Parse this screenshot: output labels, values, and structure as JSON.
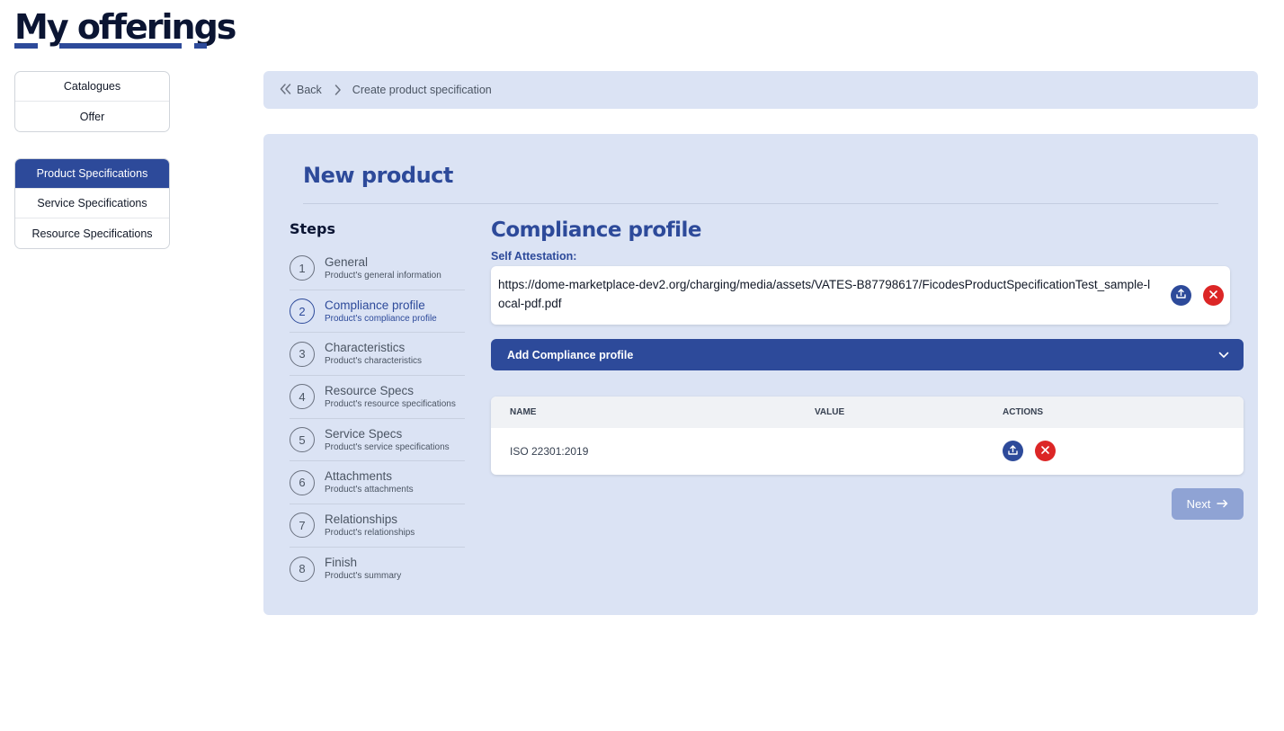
{
  "header": {
    "title": "My offerings"
  },
  "sidebar": {
    "group1": [
      {
        "label": "Catalogues"
      },
      {
        "label": "Offer"
      }
    ],
    "group2": [
      {
        "label": "Product Specifications",
        "active": true
      },
      {
        "label": "Service Specifications"
      },
      {
        "label": "Resource Specifications"
      }
    ]
  },
  "breadcrumb": {
    "back": "Back",
    "current": "Create product specification"
  },
  "panel": {
    "title": "New product"
  },
  "steps": {
    "title": "Steps",
    "items": [
      {
        "num": "1",
        "name": "General",
        "desc": "Product's general information"
      },
      {
        "num": "2",
        "name": "Compliance profile",
        "desc": "Product's compliance profile",
        "active": true
      },
      {
        "num": "3",
        "name": "Characteristics",
        "desc": "Product's characteristics"
      },
      {
        "num": "4",
        "name": "Resource Specs",
        "desc": "Product's resource specifications"
      },
      {
        "num": "5",
        "name": "Service Specs",
        "desc": "Product's service specifications"
      },
      {
        "num": "6",
        "name": "Attachments",
        "desc": "Product's attachments"
      },
      {
        "num": "7",
        "name": "Relationships",
        "desc": "Product's relationships"
      },
      {
        "num": "8",
        "name": "Finish",
        "desc": "Product's summary"
      }
    ]
  },
  "compliance": {
    "title": "Compliance profile",
    "self_attestation_label": "Self Attestation:",
    "file_url": "https://dome-marketplace-dev2.org/charging/media/assets/VATES-B87798617/FicodesProductSpecificationTest_sample-local-pdf.pdf",
    "accordion_label": "Add Compliance profile",
    "table": {
      "headers": {
        "name": "NAME",
        "value": "VALUE",
        "actions": "ACTIONS"
      },
      "rows": [
        {
          "name": "ISO 22301:2019",
          "value": ""
        }
      ]
    },
    "next_label": "Next"
  },
  "colors": {
    "primary": "#2d4a9a",
    "panel_bg": "#dbe3f4",
    "danger": "#dc2626",
    "next_disabled": "#8fa3d4"
  },
  "icons": [
    "chevrons-left-icon",
    "chevron-right-icon",
    "upload-icon",
    "close-icon",
    "chevron-down-icon",
    "arrow-right-icon"
  ]
}
